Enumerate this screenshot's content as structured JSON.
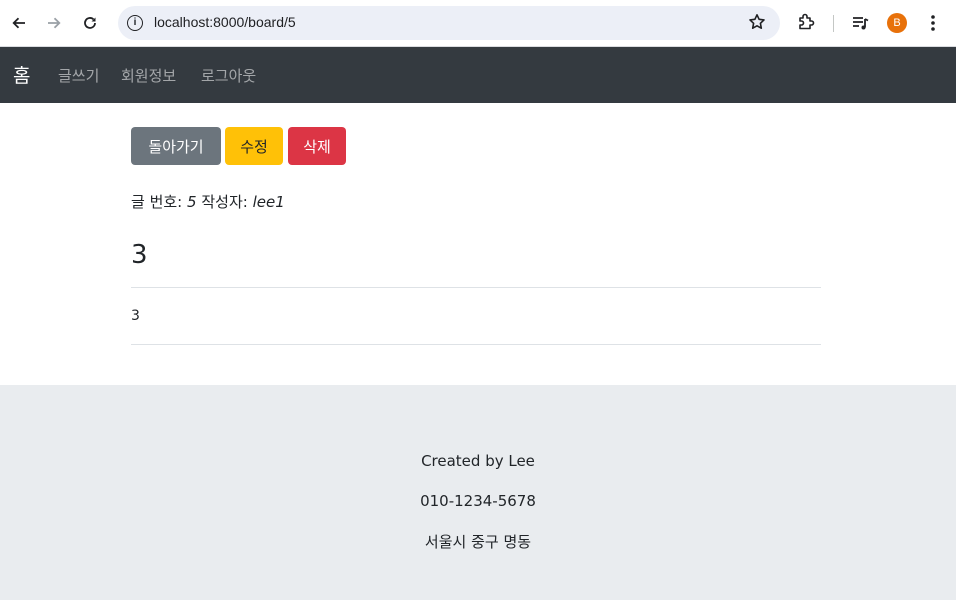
{
  "browser": {
    "url": "localhost:8000/board/5",
    "profile_initial": "B",
    "profile_color": "#e8710a",
    "icons": [
      "back-icon",
      "forward-icon",
      "reload-icon",
      "site-info-icon",
      "bookmark-star-icon",
      "extensions-icon",
      "media-queue-icon",
      "more-menu-icon"
    ]
  },
  "navbar": {
    "brand": "홈",
    "links": [
      "글쓰기",
      "회원정보",
      "로그아웃"
    ],
    "background": "#343a40"
  },
  "actions": {
    "back_label": "돌아가기",
    "edit_label": "수정",
    "delete_label": "삭제"
  },
  "post": {
    "number_label": "글 번호:",
    "number": "5",
    "author_label": "작성자:",
    "author": "lee1",
    "title": "3",
    "content": "3"
  },
  "footer": {
    "created_by": "Created by Lee",
    "phone": "010-1234-5678",
    "address": "서울시 중구 명동"
  }
}
